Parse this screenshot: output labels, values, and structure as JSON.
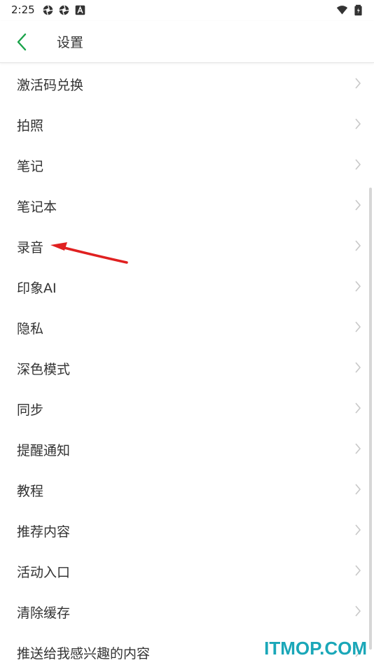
{
  "status_bar": {
    "time": "2:25"
  },
  "colors": {
    "accent": "#1aa34a",
    "text": "#333333",
    "chevron": "#c8c8c8",
    "annotation": "#e02020",
    "watermark": "#1aa7b8"
  },
  "header": {
    "title": "设置"
  },
  "settings": {
    "items": [
      {
        "label": "激活码兑换"
      },
      {
        "label": "拍照"
      },
      {
        "label": "笔记"
      },
      {
        "label": "笔记本"
      },
      {
        "label": "录音"
      },
      {
        "label": "印象AI"
      },
      {
        "label": "隐私"
      },
      {
        "label": "深色模式"
      },
      {
        "label": "同步"
      },
      {
        "label": "提醒通知"
      },
      {
        "label": "教程"
      },
      {
        "label": "推荐内容"
      },
      {
        "label": "活动入口"
      },
      {
        "label": "清除缓存"
      },
      {
        "label": "推送给我感兴趣的内容"
      }
    ]
  },
  "watermark": {
    "text": "ITMOP.COM"
  }
}
